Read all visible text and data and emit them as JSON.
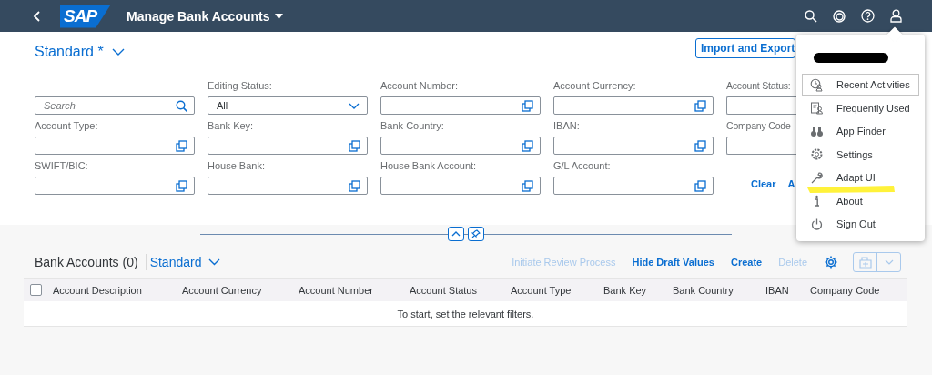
{
  "shell": {
    "logo": "SAP",
    "title": "Manage Bank Accounts"
  },
  "variant": {
    "name": "Standard *"
  },
  "import_button": "Import and Export",
  "filters": [
    {
      "kind": "search",
      "placeholder": "Search"
    },
    {
      "kind": "select",
      "label": "Editing Status:",
      "value": "All"
    },
    {
      "kind": "valuehelp",
      "label": "Account Number:"
    },
    {
      "kind": "valuehelp",
      "label": "Account Currency:"
    },
    {
      "kind": "valuehelp",
      "label": "Account Status:"
    },
    {
      "kind": "valuehelp",
      "label": "Account Type:"
    },
    {
      "kind": "valuehelp",
      "label": "Bank Key:"
    },
    {
      "kind": "valuehelp",
      "label": "Bank Country:"
    },
    {
      "kind": "valuehelp",
      "label": "IBAN:"
    },
    {
      "kind": "valuehelp",
      "label": "Company Code"
    },
    {
      "kind": "valuehelp",
      "label": "SWIFT/BIC:"
    },
    {
      "kind": "valuehelp",
      "label": "House Bank:"
    },
    {
      "kind": "valuehelp",
      "label": "House Bank Account:"
    },
    {
      "kind": "valuehelp",
      "label": "G/L Account:"
    }
  ],
  "filter_actions": [
    "Clear",
    "A"
  ],
  "table": {
    "title": "Bank Accounts (0)",
    "variant": "Standard",
    "actions": [
      {
        "label": "Initiate Review Process",
        "disabled": true
      },
      {
        "label": "Hide Draft Values",
        "disabled": false
      },
      {
        "label": "Create",
        "disabled": false
      },
      {
        "label": "Delete",
        "disabled": true
      }
    ],
    "select_all": {
      "checked": false
    },
    "columns": [
      "Account Description",
      "Account Currency",
      "Account Number",
      "Account Status",
      "Account Type",
      "Bank Key",
      "Bank Country",
      "IBAN",
      "Company Code"
    ],
    "empty_text": "To start, set the relevant filters."
  },
  "user_menu": {
    "items": [
      {
        "label": "Recent Activities",
        "selected": true
      },
      {
        "label": "Frequently Used",
        "selected": false
      },
      {
        "label": "App Finder",
        "selected": false
      },
      {
        "label": "Settings",
        "selected": false
      },
      {
        "label": "Adapt UI",
        "selected": false
      },
      {
        "label": "About",
        "selected": false
      },
      {
        "label": "Sign Out",
        "selected": false
      }
    ]
  }
}
